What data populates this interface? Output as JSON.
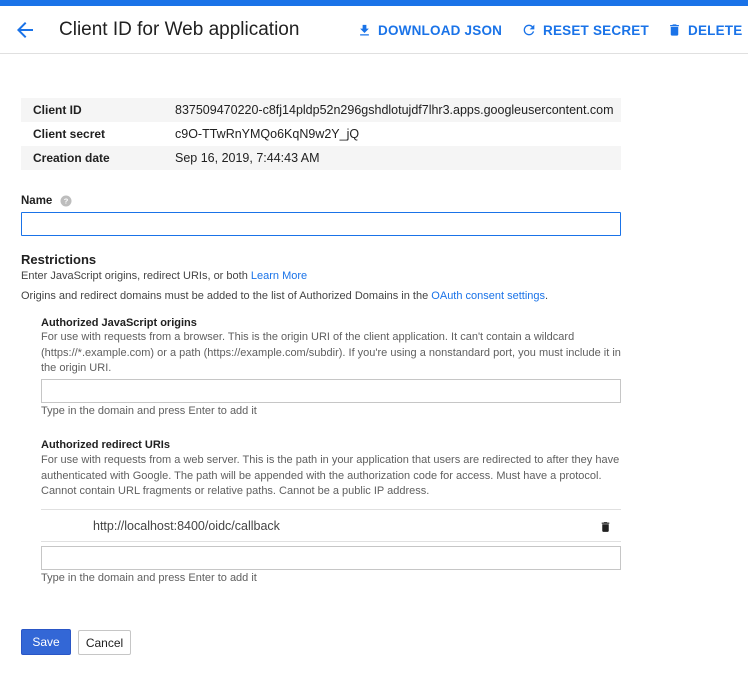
{
  "header": {
    "title": "Client ID for Web application",
    "download_label": "DOWNLOAD JSON",
    "reset_label": "RESET SECRET",
    "delete_label": "DELETE"
  },
  "info": [
    {
      "label": "Client ID",
      "value": "837509470220-c8fj14pldp52n296gshdlotujdf7lhr3.apps.googleusercontent.com"
    },
    {
      "label": "Client secret",
      "value": "c9O-TTwRnYMQo6KqN9w2Y_jQ"
    },
    {
      "label": "Creation date",
      "value": "Sep 16, 2019, 7:44:43 AM"
    }
  ],
  "name_field": {
    "label": "Name",
    "value": ""
  },
  "restrictions": {
    "title": "Restrictions",
    "desc": "Enter JavaScript origins, redirect URIs, or both",
    "learn_more": "Learn More",
    "desc2": "Origins and redirect domains must be added to the list of Authorized Domains in the",
    "oauth_link": "OAuth consent settings",
    "desc2_end": "."
  },
  "js_origins": {
    "title": "Authorized JavaScript origins",
    "desc": "For use with requests from a browser. This is the origin URI of the client application. It can't contain a wildcard (https://*.example.com) or a path (https://example.com/subdir). If you're using a nonstandard port, you must include it in the origin URI.",
    "hint": "Type in the domain and press Enter to add it"
  },
  "redirect_uris": {
    "title": "Authorized redirect URIs",
    "desc": "For use with requests from a web server. This is the path in your application that users are redirected to after they have authenticated with Google. The path will be appended with the authorization code for access. Must have a protocol. Cannot contain URL fragments or relative paths. Cannot be a public IP address.",
    "items": [
      "http://localhost:8400/oidc/callback"
    ],
    "hint": "Type in the domain and press Enter to add it"
  },
  "actions": {
    "save_label": "Save",
    "cancel_label": "Cancel"
  },
  "colors": {
    "accent": "#1a73e8",
    "save_bg": "#3367d6"
  }
}
